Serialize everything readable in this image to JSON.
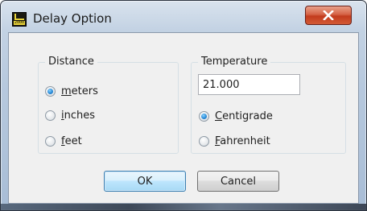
{
  "window": {
    "title": "Delay Option",
    "icon": "d-2000-app-icon",
    "icon_text": "2000",
    "close_label": "X"
  },
  "distance": {
    "label": "Distance",
    "options": [
      {
        "label": "meters",
        "mnemonic": "m",
        "rest": "eters",
        "checked": true
      },
      {
        "label": "inches",
        "mnemonic": "i",
        "rest": "nches",
        "checked": false
      },
      {
        "label": "feet",
        "mnemonic": "f",
        "rest": "eet",
        "checked": false
      }
    ]
  },
  "temperature": {
    "label": "Temperature",
    "value": "21.000",
    "options": [
      {
        "label": "Centigrade",
        "mnemonic": "C",
        "rest": "entigrade",
        "checked": true
      },
      {
        "label": "Fahrenheit",
        "mnemonic": "F",
        "rest": "ahrenheit",
        "checked": false
      }
    ]
  },
  "buttons": {
    "ok": "OK",
    "cancel": "Cancel"
  },
  "colors": {
    "accent": "#2a8bd8",
    "close_button": "#c23b1d"
  }
}
